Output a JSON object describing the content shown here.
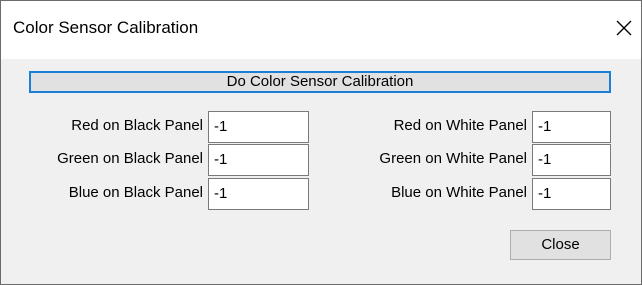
{
  "window": {
    "title": "Color Sensor Calibration"
  },
  "actions": {
    "calibrate_label": "Do Color Sensor Calibration",
    "close_label": "Close"
  },
  "black_panel": [
    {
      "label": "Red on Black Panel",
      "value": "-1"
    },
    {
      "label": "Green on Black Panel",
      "value": "-1"
    },
    {
      "label": "Blue on Black Panel",
      "value": "-1"
    }
  ],
  "white_panel": [
    {
      "label": "Red on White Panel",
      "value": "-1"
    },
    {
      "label": "Green on White Panel",
      "value": "-1"
    },
    {
      "label": "Blue on White Panel",
      "value": "-1"
    }
  ],
  "icons": {
    "close": "close-icon"
  },
  "colors": {
    "focus_border": "#1b7fd6",
    "button_face": "#e1e1e1",
    "dialog_bg": "#f0f0f0"
  }
}
